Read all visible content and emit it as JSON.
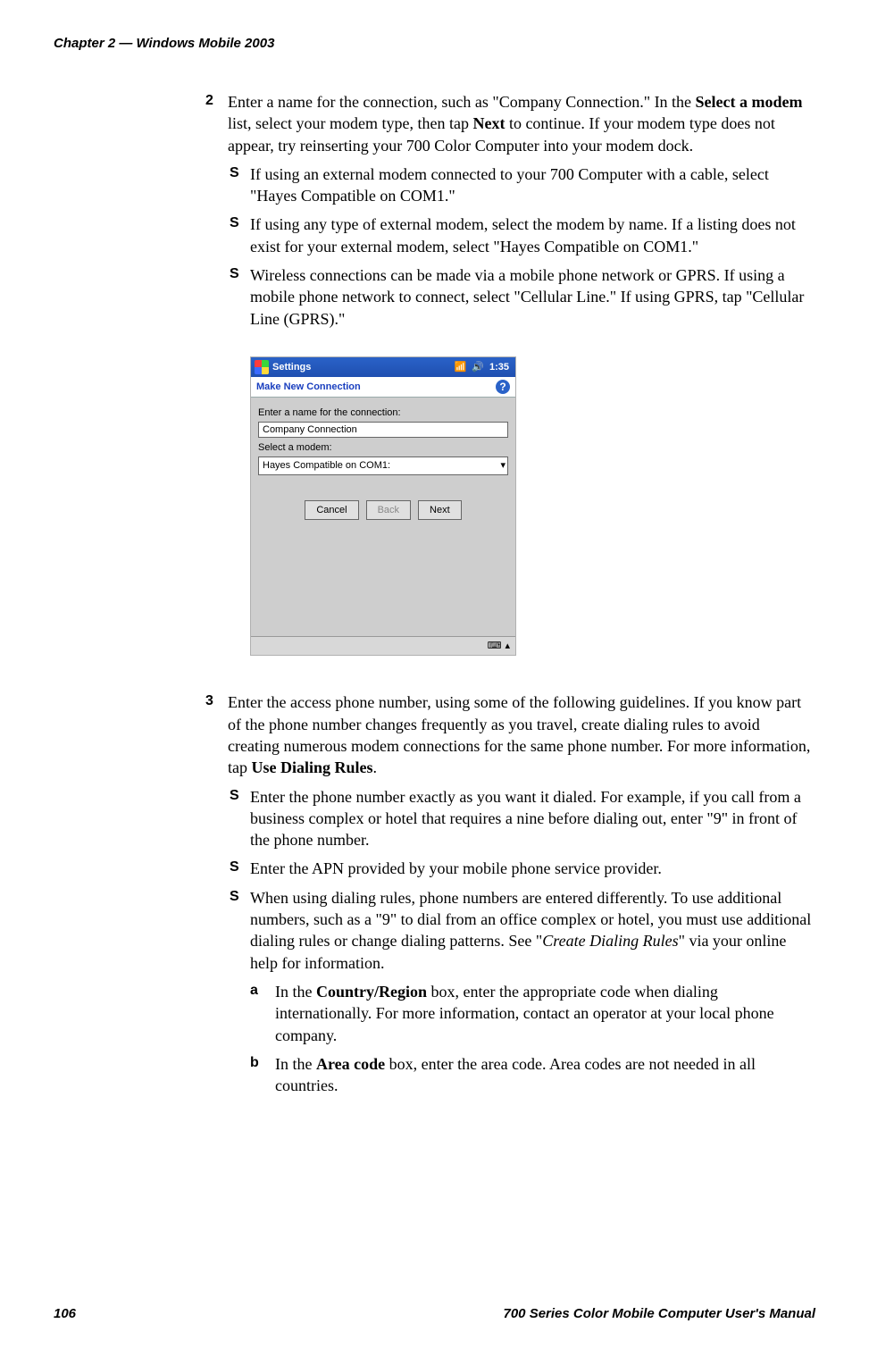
{
  "header": {
    "left": "Chapter 2  —  Windows Mobile 2003"
  },
  "footer": {
    "page": "106",
    "title": "700 Series Color Mobile Computer User's Manual"
  },
  "steps": {
    "s2": {
      "num": "2",
      "para": "Enter a name for the connection, such as \"Company Connection.\" In the ",
      "bold1": "Select a modem",
      "mid1": " list, select your modem type, then tap ",
      "bold2": "Next",
      "tail": " to continue. If your modem type does not appear, try reinserting your 700 Color Computer into your modem dock.",
      "b1": "If using an external modem connected to your 700 Computer with a cable, select \"Hayes Compatible on COM1.\"",
      "b2": "If using any type of external modem, select the modem by name. If a listing does not exist for your external modem, select \"Hayes Compatible on COM1.\"",
      "b3": "Wireless connections can be made via a mobile phone network or GPRS. If using a mobile phone network to connect, select \"Cellular Line.\" If using GPRS, tap \"Cellular Line (GPRS).\""
    },
    "s3": {
      "num": "3",
      "para_pre": "Enter the access phone number, using some of the following guidelines. If you know part of the phone number changes frequently as you travel, create dialing rules to avoid creating numerous modem connections for the same phone number. For more information, tap ",
      "para_bold": "Use Dialing Rules",
      "para_post": ".",
      "b1": "Enter the phone number exactly as you want it dialed. For example, if you call from a business complex or hotel that requires a nine before dialing out, enter \"9\" in front of the phone number.",
      "b2": "Enter the APN provided by your mobile phone service provider.",
      "b3_pre": "When using dialing rules, phone numbers are entered differently. To use additional numbers, such as a \"9\" to dial from an office complex or hotel, you must use additional dialing rules or change dialing patterns. See \"",
      "b3_ital": "Create Dialing Rules",
      "b3_post": "\" via your online help for information.",
      "a": {
        "num": "a",
        "pre": "In the ",
        "bold": "Country/Region",
        "post": " box, enter the appropriate code when dialing internationally. For more information, contact an operator at your local phone company."
      },
      "b": {
        "num": "b",
        "pre": "In the ",
        "bold": "Area code",
        "post": " box, enter the area code. Area codes are not needed in all countries."
      }
    }
  },
  "screenshot": {
    "title": "Settings",
    "time": "1:35",
    "subhead": "Make New Connection",
    "label1": "Enter a name for the connection:",
    "input1": "Company Connection",
    "label2": "Select a modem:",
    "select1": "Hayes Compatible on COM1:",
    "btn_cancel": "Cancel",
    "btn_back": "Back",
    "btn_next": "Next",
    "signal_icon": "signal-icon",
    "speaker_icon": "speaker-icon",
    "help_icon": "?",
    "kbd": "⌨",
    "up": "▴",
    "dropdown_arrow": "▾"
  }
}
